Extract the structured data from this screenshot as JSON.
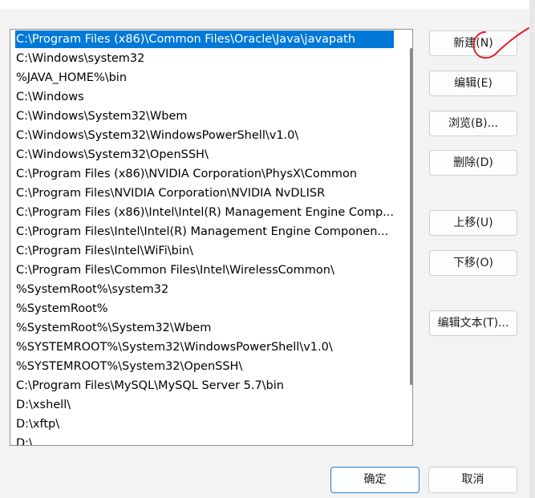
{
  "path_list": {
    "items": [
      {
        "label": "C:\\Program Files (x86)\\Common Files\\Oracle\\Java\\javapath",
        "selected": true
      },
      {
        "label": "C:\\Windows\\system32"
      },
      {
        "label": "%JAVA_HOME%\\bin"
      },
      {
        "label": "C:\\Windows"
      },
      {
        "label": "C:\\Windows\\System32\\Wbem"
      },
      {
        "label": "C:\\Windows\\System32\\WindowsPowerShell\\v1.0\\"
      },
      {
        "label": "C:\\Windows\\System32\\OpenSSH\\"
      },
      {
        "label": "C:\\Program Files (x86)\\NVIDIA Corporation\\PhysX\\Common"
      },
      {
        "label": "C:\\Program Files\\NVIDIA Corporation\\NVIDIA NvDLISR"
      },
      {
        "label": "C:\\Program Files (x86)\\Intel\\Intel(R) Management Engine Comp..."
      },
      {
        "label": "C:\\Program Files\\Intel\\Intel(R) Management Engine Componen..."
      },
      {
        "label": "C:\\Program Files\\Intel\\WiFi\\bin\\"
      },
      {
        "label": "C:\\Program Files\\Common Files\\Intel\\WirelessCommon\\"
      },
      {
        "label": "%SystemRoot%\\system32"
      },
      {
        "label": "%SystemRoot%"
      },
      {
        "label": "%SystemRoot%\\System32\\Wbem"
      },
      {
        "label": "%SYSTEMROOT%\\System32\\WindowsPowerShell\\v1.0\\"
      },
      {
        "label": "%SYSTEMROOT%\\System32\\OpenSSH\\"
      },
      {
        "label": "C:\\Program Files\\MySQL\\MySQL Server 5.7\\bin"
      },
      {
        "label": "D:\\xshell\\"
      },
      {
        "label": "D:\\xftp\\"
      },
      {
        "label": "D:\\"
      }
    ],
    "selection_color": "#0078d7"
  },
  "buttons": {
    "new": "新建(N)",
    "edit": "编辑(E)",
    "browse": "浏览(B)...",
    "delete": "删除(D)",
    "move_up": "上移(U)",
    "move_down": "下移(O)",
    "edit_text": "编辑文本(T)...",
    "ok": "确定",
    "cancel": "取消"
  },
  "annotation": {
    "color": "#e0202a",
    "description": "red-handwritten-check-mark"
  }
}
